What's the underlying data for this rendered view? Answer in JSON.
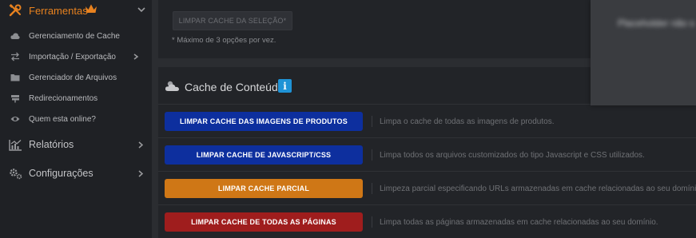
{
  "sidebar": {
    "section": {
      "label": "Ferramentas",
      "icon": "tools-icon",
      "badge_icon": "crown-icon"
    },
    "items": [
      {
        "label": "Gerenciamento de Cache",
        "icon": "cloud-icon"
      },
      {
        "label": "Importação / Exportação",
        "icon": "swap-icon",
        "has_submenu": true
      },
      {
        "label": "Gerenciador de Arquivos",
        "icon": "folder-icon"
      },
      {
        "label": "Redirecionamentos",
        "icon": "signpost-icon"
      },
      {
        "label": "Quem esta online?",
        "icon": "eye-icon"
      }
    ],
    "main": [
      {
        "label": "Relatórios",
        "icon": "chart-icon"
      },
      {
        "label": "Configurações",
        "icon": "cogs-icon"
      }
    ]
  },
  "top_panel": {
    "clear_selection_button": "LIMPAR CACHE DA SELEÇÃO*",
    "note": "* Máximo de 3 opções por vez."
  },
  "overlay": {
    "text": "Placeholder não s"
  },
  "cache": {
    "title": "Cache de Conteúdo",
    "info_badge": "i",
    "actions": [
      {
        "button": "LIMPAR CACHE DAS IMAGENS DE PRODUTOS",
        "description": "Limpa o cache de todas as imagens de produtos.",
        "color": "#0d2f9e"
      },
      {
        "button": "LIMPAR CACHE DE JAVASCRIPT/CSS",
        "description": "Limpa todos os arquivos customizados do tipo Javascript e CSS utilizados.",
        "color": "#0d2f9e"
      },
      {
        "button": "LIMPAR CACHE PARCIAL",
        "description": "Limpeza parcial especificando URLs armazenadas em cache relacionadas ao seu domínio.",
        "color": "#cf7716"
      },
      {
        "button": "LIMPAR CACHE DE TODAS AS PÁGINAS",
        "description": "Limpa todas as páginas armazenadas em cache relacionadas ao seu domínio.",
        "color": "#9f1d1d"
      }
    ]
  },
  "colors": {
    "accent": "#e8821f",
    "info": "#1f93d6",
    "background": "#2b2d31",
    "sidebar": "#1f2125"
  }
}
